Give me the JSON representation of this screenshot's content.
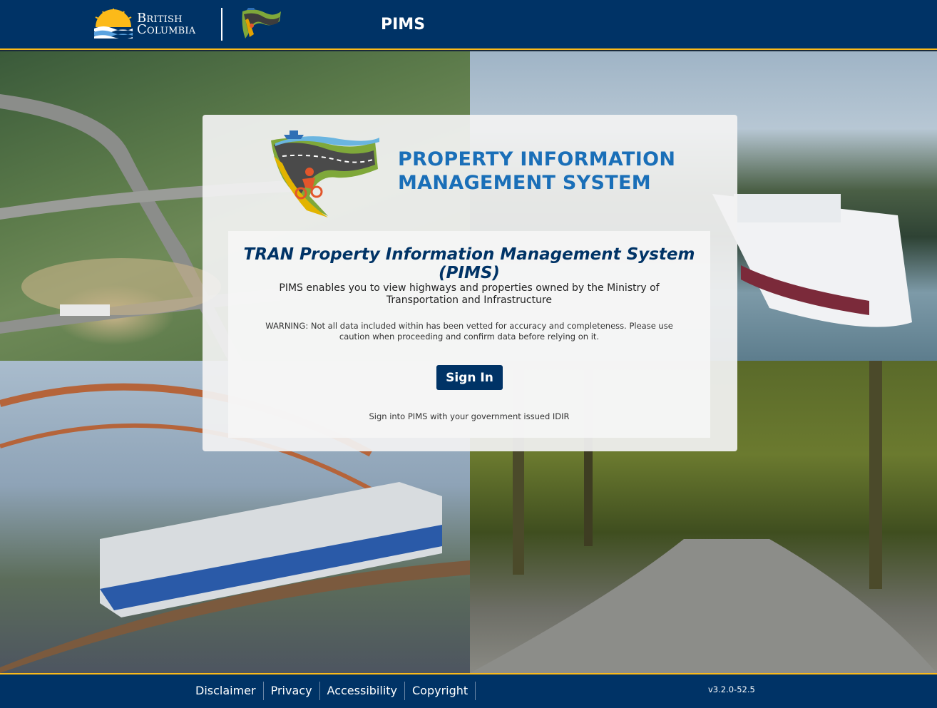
{
  "header": {
    "brand_line1": "British",
    "brand_line2": "Columbia",
    "app_title": "PIMS"
  },
  "card": {
    "heading_line1": "PROPERTY INFORMATION",
    "heading_line2": "MANAGEMENT SYSTEM",
    "subtitle": "TRAN Property Information Management System (PIMS)",
    "description": "PIMS enables you to view highways and properties owned by the Ministry of Transportation and Infrastructure",
    "warning": "WARNING: Not all data included within has been vetted for accuracy and completeness. Please use caution when proceeding and confirm data before relying on it.",
    "signin_label": "Sign In",
    "signin_hint": "Sign into PIMS with your government issued IDIR"
  },
  "footer": {
    "links": [
      "Disclaimer",
      "Privacy",
      "Accessibility",
      "Copyright"
    ],
    "version": "v3.2.0-52.5"
  },
  "colors": {
    "brand_blue": "#003366",
    "accent_gold": "#fcba19",
    "heading_blue": "#1a6fb8"
  },
  "icons": [
    "bc-sun-logo-icon",
    "pims-road-logo-icon",
    "cyclist-icon",
    "ferry-icon"
  ]
}
